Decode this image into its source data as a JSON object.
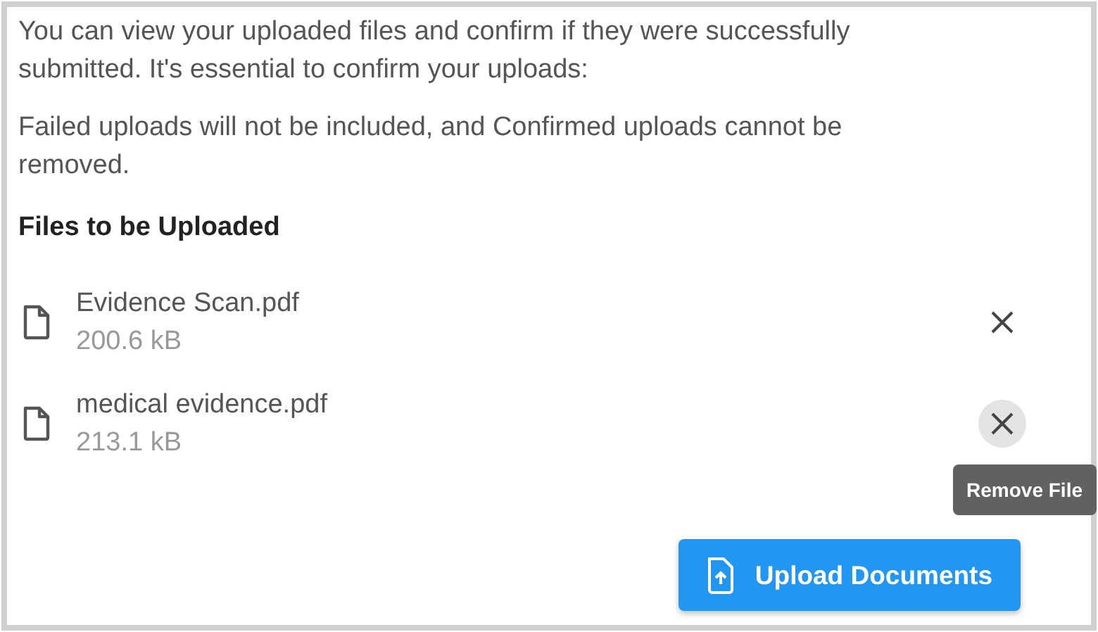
{
  "intro": [
    "You can view your uploaded files and confirm if they were successfully submitted. It's essential to confirm your uploads:",
    "Failed uploads will not be included, and Confirmed uploads cannot be removed."
  ],
  "heading": "Files to be Uploaded",
  "files": [
    {
      "name": "Evidence Scan.pdf",
      "size": "200.6 kB",
      "hovered": false
    },
    {
      "name": "medical evidence.pdf",
      "size": "213.1 kB",
      "hovered": true,
      "tooltip": "Remove File"
    }
  ],
  "upload_button": "Upload Documents"
}
